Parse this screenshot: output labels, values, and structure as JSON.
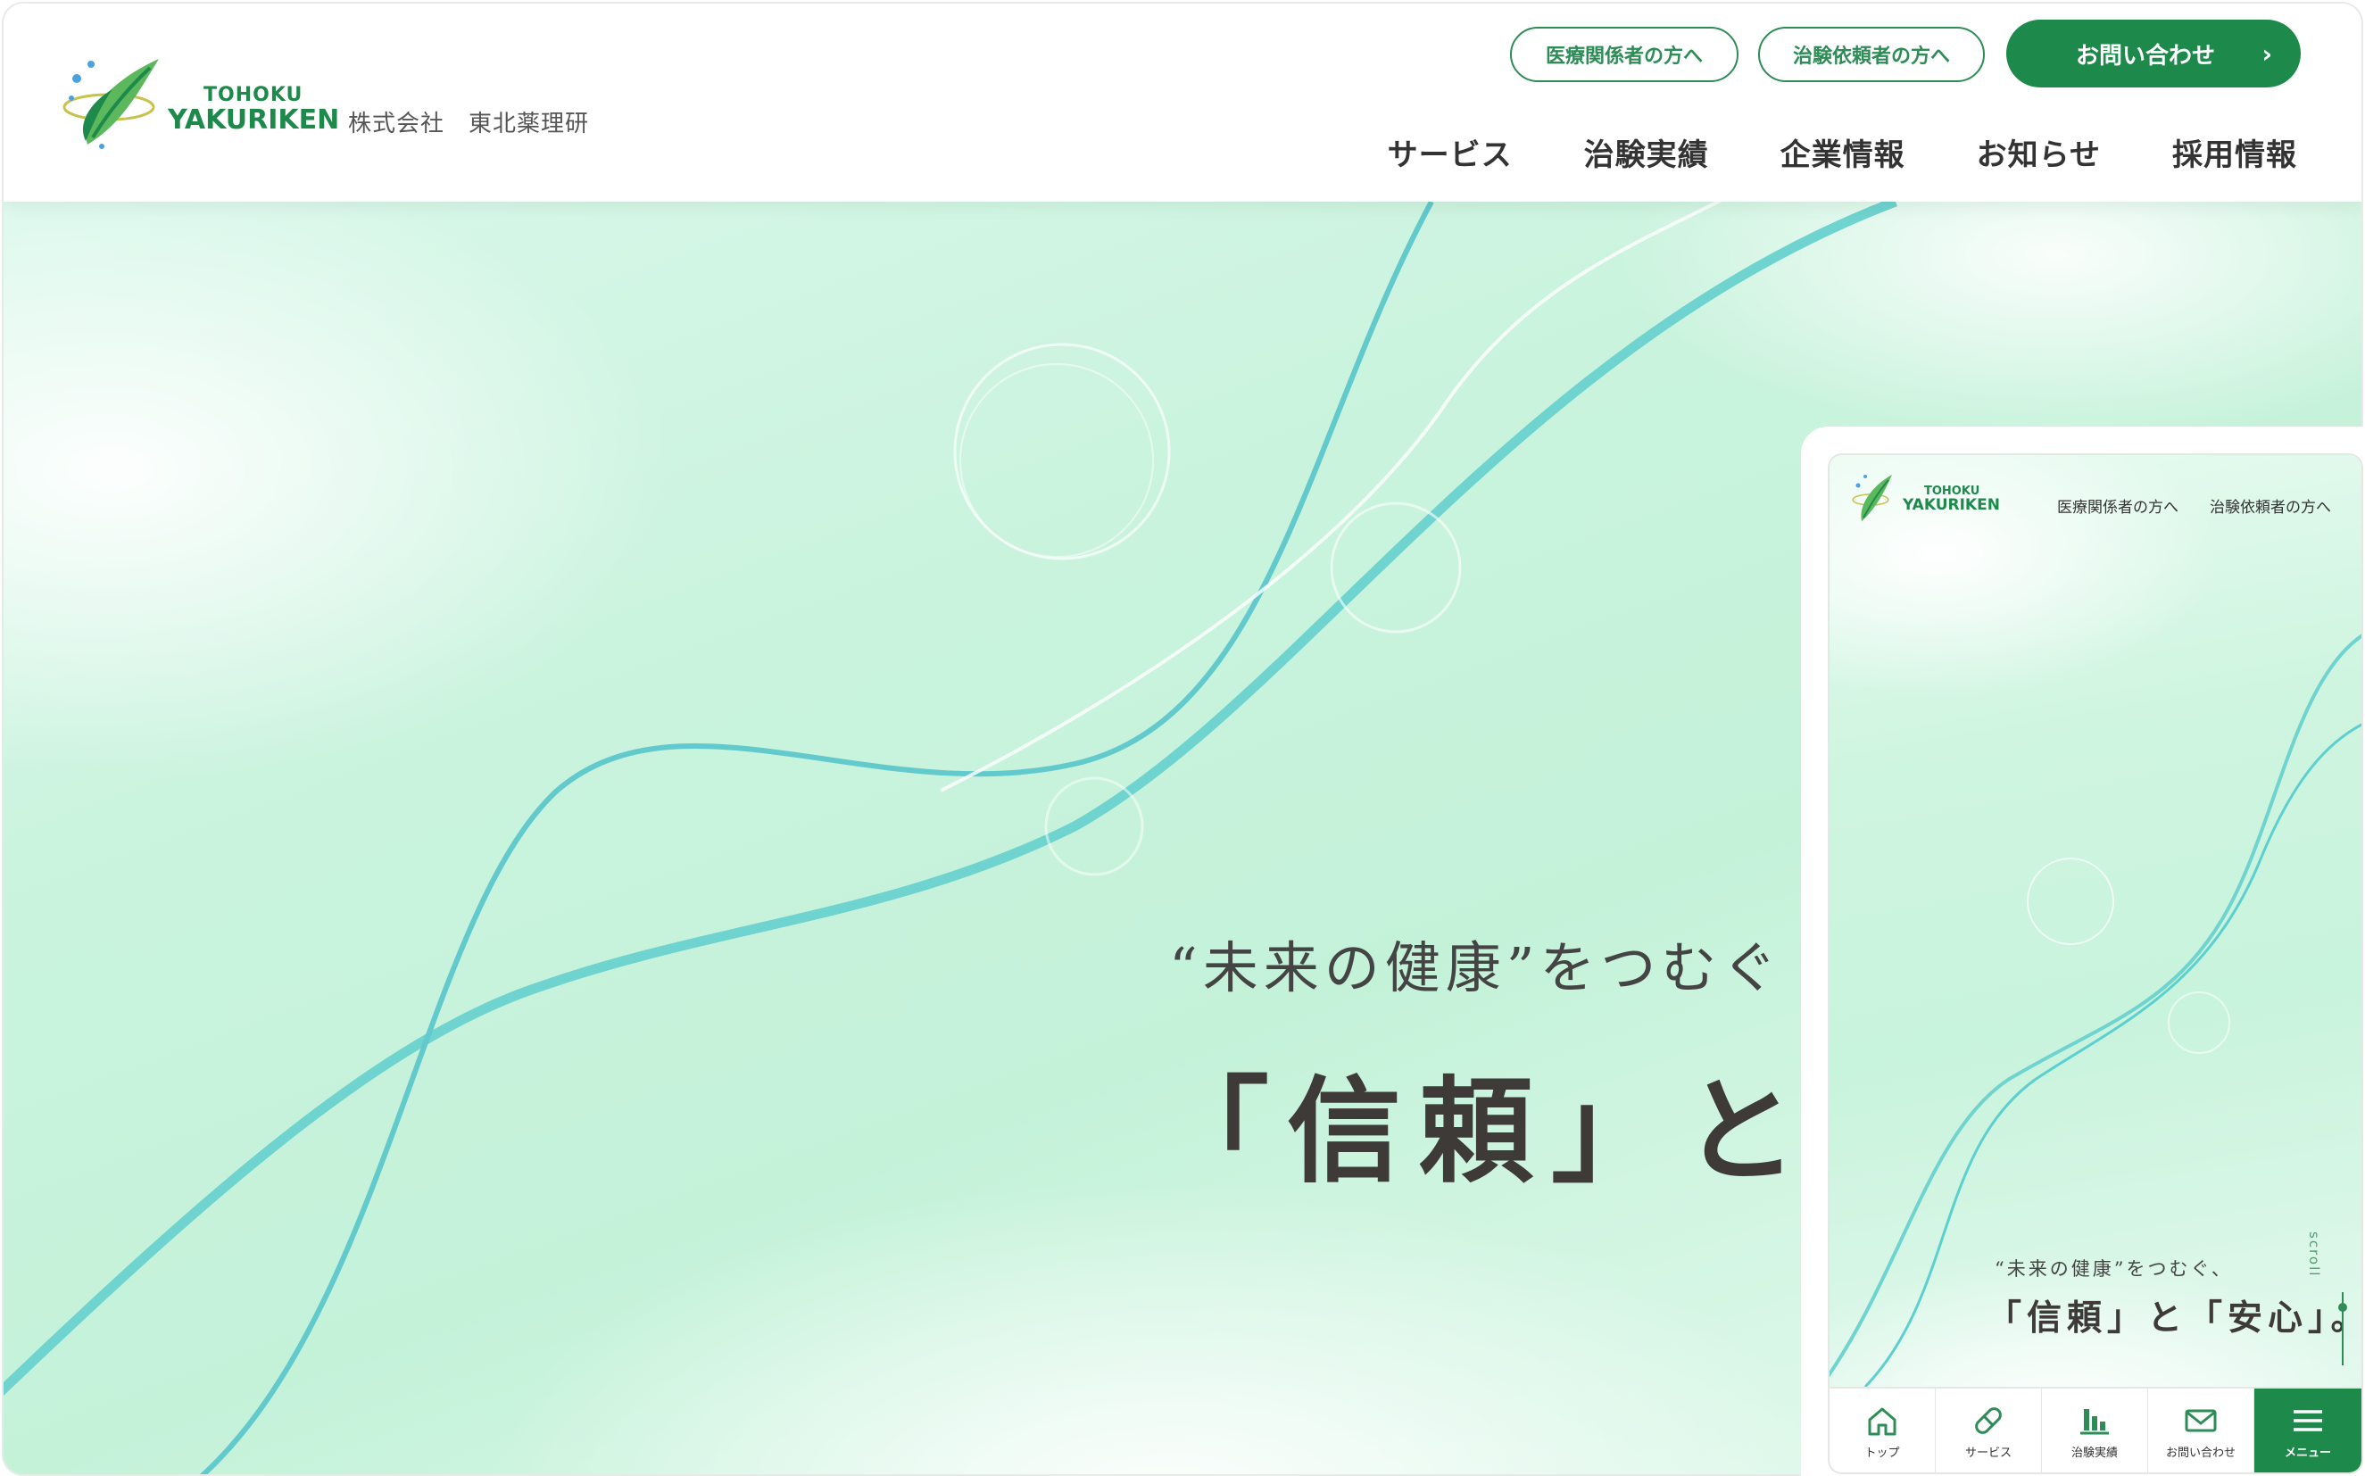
{
  "brand": {
    "logo_line1": "TOHOKU",
    "logo_line2": "YAKURIKEN",
    "company_name": "株式会社　東北薬理研",
    "color_primary": "#1d8a4b",
    "color_hero": "#c9f3dd",
    "color_wave": "#5ccfcf"
  },
  "header": {
    "link_medical": "医療関係者の方へ",
    "link_client": "治験依頼者の方へ",
    "contact_button": "お問い合わせ",
    "contact_chevron": "›",
    "nav": [
      "サービス",
      "治験実績",
      "企業情報",
      "お知らせ",
      "採用情報"
    ]
  },
  "hero": {
    "tagline_small": "“未来の健康”をつむぐ",
    "tagline_large": "「信頼」と「安"
  },
  "mobile": {
    "link_medical": "医療関係者の方へ",
    "link_client": "治験依頼者の方へ",
    "tagline_small": "“未来の健康”をつむぐ、",
    "tagline_large": "「信頼」と「安心」。",
    "scroll_label": "scroll",
    "tabs": [
      {
        "label": "トップ",
        "icon": "home-icon"
      },
      {
        "label": "サービス",
        "icon": "pill-icon"
      },
      {
        "label": "治験実績",
        "icon": "bar-chart-icon"
      },
      {
        "label": "お問い合わせ",
        "icon": "mail-icon"
      },
      {
        "label": "メニュー",
        "icon": "menu-icon"
      }
    ]
  }
}
